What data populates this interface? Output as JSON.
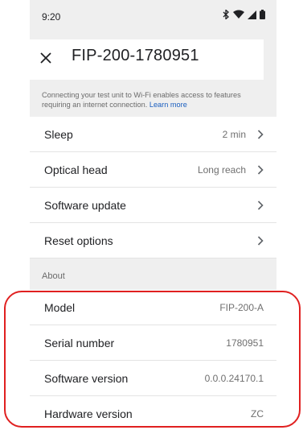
{
  "status_bar": {
    "time": "9:20",
    "icons": [
      "bluetooth-icon",
      "wifi-icon",
      "signal-icon",
      "battery-icon"
    ]
  },
  "header": {
    "close_icon": "close-icon",
    "title": "FIP-200-1780951"
  },
  "info": {
    "text": "Connecting your test unit to Wi-Fi enables access to features requiring an internet connection.",
    "link": "Learn more"
  },
  "settings": [
    {
      "label": "Sleep",
      "value": "2 min"
    },
    {
      "label": "Optical head",
      "value": "Long reach"
    },
    {
      "label": "Software update",
      "value": ""
    },
    {
      "label": "Reset options",
      "value": ""
    }
  ],
  "about": {
    "section_label": "About",
    "items": [
      {
        "label": "Model",
        "value": "FIP-200-A"
      },
      {
        "label": "Serial number",
        "value": "1780951"
      },
      {
        "label": "Software version",
        "value": "0.0.0.24170.1"
      },
      {
        "label": "Hardware version",
        "value": "ZC"
      }
    ]
  },
  "colors": {
    "background": "#efefef",
    "card": "#ffffff",
    "link": "#1a5ebf",
    "highlight": "#e02020"
  }
}
